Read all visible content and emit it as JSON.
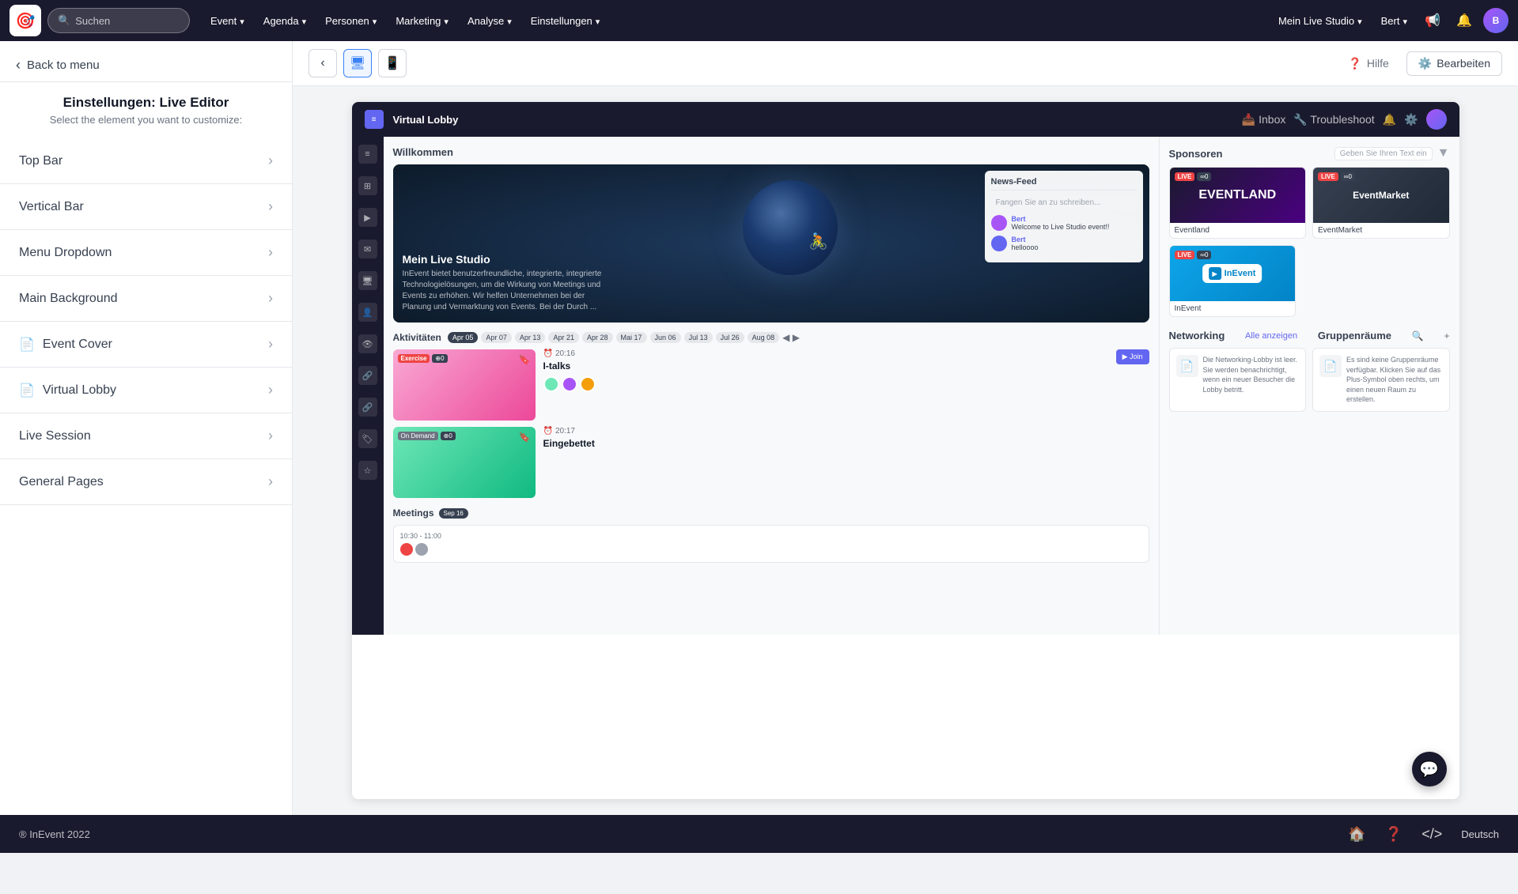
{
  "nav": {
    "logo": "🎯",
    "search_placeholder": "Suchen",
    "menu_items": [
      {
        "label": "Event",
        "has_dropdown": true
      },
      {
        "label": "Agenda",
        "has_dropdown": true
      },
      {
        "label": "Personen",
        "has_dropdown": true
      },
      {
        "label": "Marketing",
        "has_dropdown": true
      },
      {
        "label": "Analyse",
        "has_dropdown": true
      },
      {
        "label": "Einstellungen",
        "has_dropdown": true
      }
    ],
    "right_items": [
      {
        "label": "Mein Live Studio",
        "has_dropdown": true
      },
      {
        "label": "Bert",
        "has_dropdown": true
      }
    ]
  },
  "sidebar": {
    "back_label": "Back to menu",
    "title": "Einstellungen: Live Editor",
    "subtitle": "Select the element you want to customize:",
    "items": [
      {
        "label": "Top Bar",
        "has_icon": false
      },
      {
        "label": "Vertical Bar",
        "has_icon": false
      },
      {
        "label": "Menu Dropdown",
        "has_icon": false
      },
      {
        "label": "Main Background",
        "has_icon": false
      },
      {
        "label": "Event Cover",
        "has_icon": true
      },
      {
        "label": "Virtual Lobby",
        "has_icon": true
      },
      {
        "label": "Live Session",
        "has_icon": false
      },
      {
        "label": "General Pages",
        "has_icon": false
      }
    ]
  },
  "toolbar": {
    "help_label": "Hilfe",
    "edit_label": "Bearbeiten"
  },
  "preview": {
    "vl_title": "Virtual Lobby",
    "welcome": "Willkommen",
    "studio_name": "Mein Live Studio",
    "studio_desc": "InEvent bietet benutzerfreundliche, integrierte, integrierte Technologielösungen, um die Wirkung von Meetings und Events zu erhöhen. Wir helfen Unternehmen bei der Planung und Vermarktung von Events. Bei der Durch ...",
    "newsfeed_title": "News-Feed",
    "newsfeed_placeholder": "Fangen Sie an zu schreiben...",
    "chat_msg_1_name": "Bert",
    "chat_msg_1_text": "Welcome to Live Studio event!!",
    "chat_msg_2_name": "Bert",
    "chat_msg_2_text": "helloooo",
    "activities_title": "Aktivitäten",
    "date_pills": [
      "Apr 05",
      "Apr 07",
      "Apr 13",
      "Apr 21",
      "Apr 28",
      "Mai 17",
      "Jun 06",
      "Jul 13",
      "Jul 26",
      "Aug 08"
    ],
    "active_date": "Apr 05",
    "session_1_time": "20:16",
    "session_1_name": "I-talks",
    "session_1_type_live": "Exercise",
    "session_1_type_count": "0",
    "session_2_time": "20:17",
    "session_2_name": "Eingebettet",
    "session_2_type": "On Demand",
    "session_2_count": "0",
    "meetings_title": "Meetings",
    "meetings_date": "Sep 16",
    "meeting_time": "10:30 - 11:00"
  },
  "right_panel": {
    "sponsors_title": "Sponsoren",
    "sponsors_search_placeholder": "Geben Sie Ihren Text ein",
    "sponsors": [
      {
        "name": "Eventland",
        "type": "dark",
        "has_live": true
      },
      {
        "name": "EventMarket",
        "type": "dark2",
        "has_live": true
      },
      {
        "name": "InEvent",
        "type": "blue",
        "has_live": true
      }
    ],
    "networking_title": "Networking",
    "networking_show_all": "Alle anzeigen",
    "gruppenraume_title": "Gruppenräume",
    "net_card_1_text": "Die Networking-Lobby ist leer. Sie werden benachrichtigt, wenn ein neuer Besucher die Lobby betritt.",
    "net_card_2_text": "Es sind keine Gruppenräume verfügbar. Klicken Sie auf das Plus-Symbol oben rechts, um einen neuen Raum zu erstellen."
  },
  "footer": {
    "copyright": "® InEvent 2022",
    "language": "Deutsch"
  }
}
